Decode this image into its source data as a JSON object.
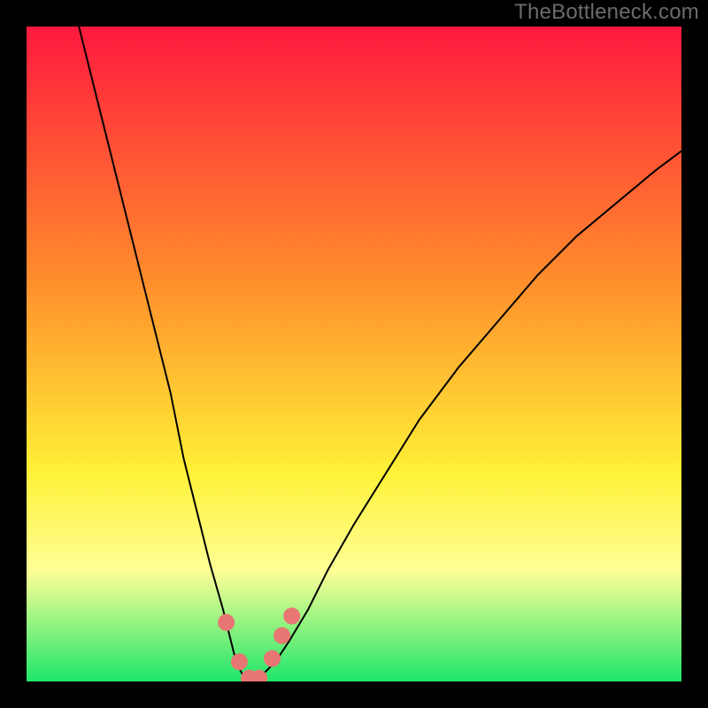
{
  "watermark_text": "TheBottleneck.com",
  "colors": {
    "gradient_top": "#ff193e",
    "gradient_mid1": "#ff8b2c",
    "gradient_mid2": "#fff137",
    "gradient_band": "#ffff96",
    "gradient_bottom": "#1ee66a",
    "curve_stroke": "#000000",
    "marker_fill": "#e87672",
    "marker_stroke": "#e87672",
    "frame": "#000000"
  },
  "chart_data": {
    "type": "line",
    "title": "",
    "xlabel": "",
    "ylabel": "",
    "xlim": [
      0,
      100
    ],
    "ylim": [
      0,
      100
    ],
    "x": [
      8,
      10,
      13,
      16,
      19,
      22,
      24,
      26,
      28,
      30,
      31,
      32,
      33,
      34,
      35,
      36,
      38,
      40,
      43,
      46,
      50,
      55,
      60,
      66,
      72,
      78,
      84,
      90,
      96,
      100
    ],
    "y": [
      100,
      92,
      80,
      68,
      56,
      44,
      34,
      26,
      18,
      11,
      7,
      3,
      1,
      0,
      0,
      1,
      3,
      6,
      11,
      17,
      24,
      32,
      40,
      48,
      55,
      62,
      68,
      73,
      78,
      81
    ],
    "markers": [
      {
        "x": 30.5,
        "y": 9
      },
      {
        "x": 32.5,
        "y": 3
      },
      {
        "x": 34.0,
        "y": 0.5
      },
      {
        "x": 35.5,
        "y": 0.5
      },
      {
        "x": 37.5,
        "y": 3.5
      },
      {
        "x": 39.0,
        "y": 7
      },
      {
        "x": 40.5,
        "y": 10
      }
    ]
  }
}
